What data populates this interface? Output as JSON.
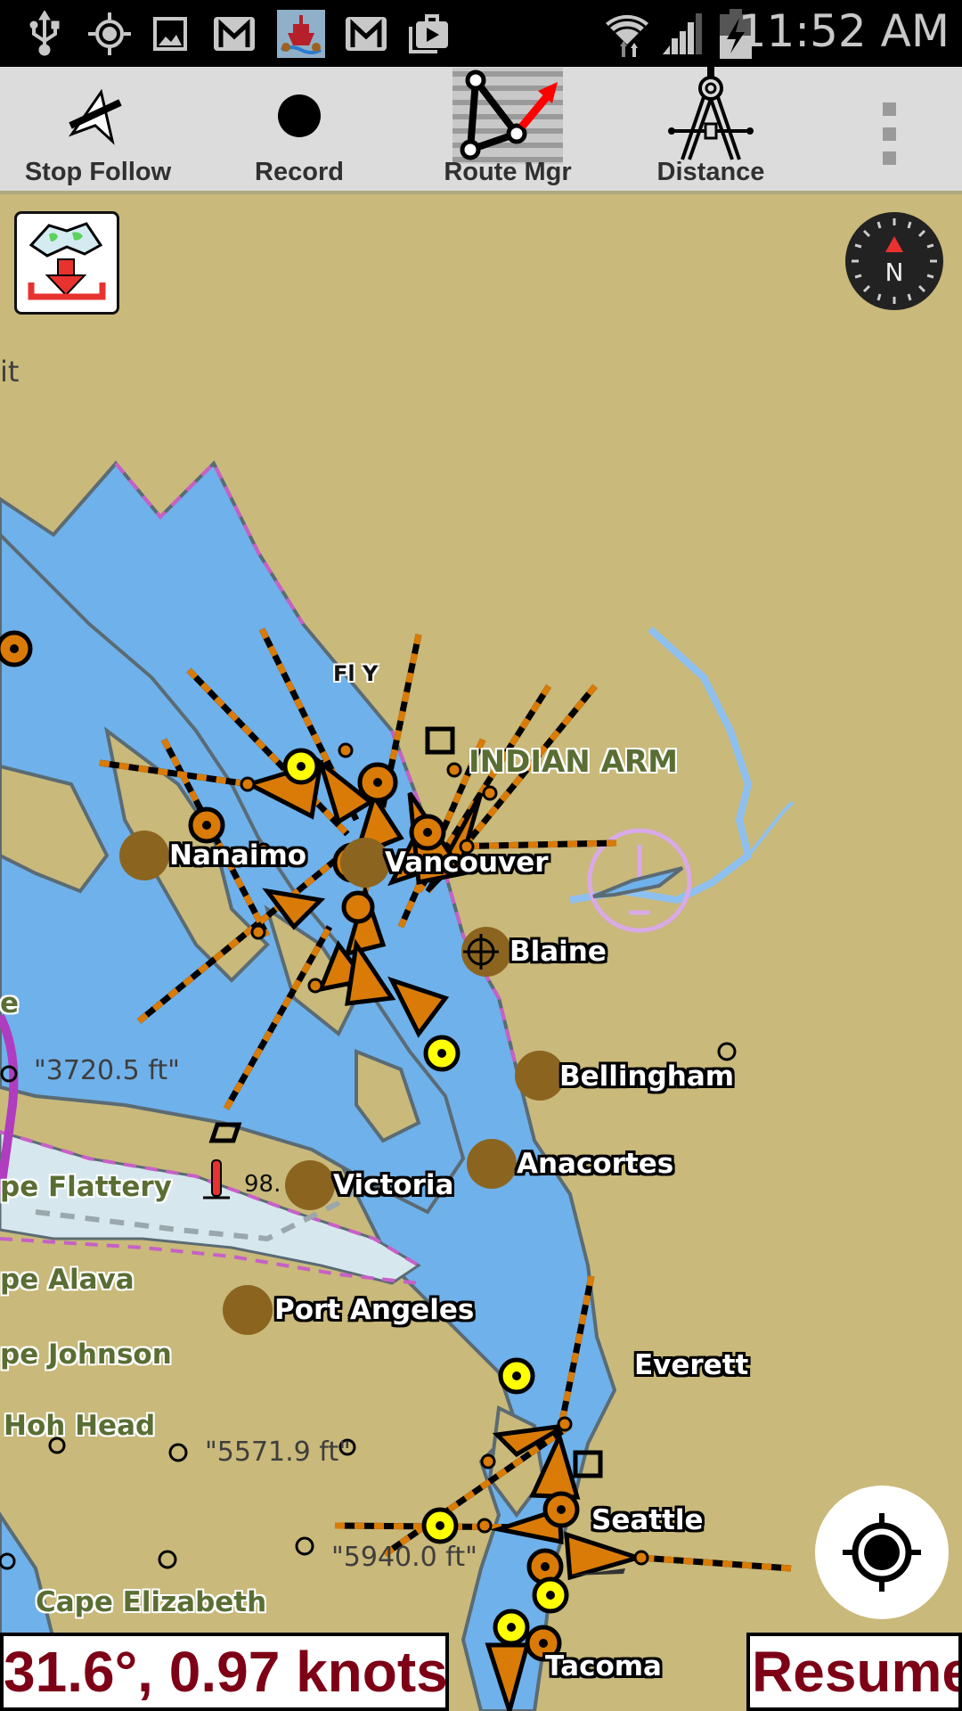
{
  "status_bar": {
    "time": "11:52 AM",
    "left_icons": [
      "usb-icon",
      "gps-icon",
      "gallery-icon",
      "gmail-icon",
      "app-boat-icon",
      "gmail-icon",
      "play-store-icon"
    ],
    "right_icons": [
      "wifi-icon",
      "signal-icon",
      "battery-charging-icon"
    ]
  },
  "action_bar": {
    "actions": [
      {
        "label": "Stop Follow",
        "icon": "stop-follow-icon"
      },
      {
        "label": "Record",
        "icon": "record-icon"
      },
      {
        "label": "Route Mgr",
        "icon": "route-manager-icon"
      },
      {
        "label": "Distance",
        "icon": "compass-divider-icon"
      }
    ],
    "overflow_icon": "more-vert-icon"
  },
  "map": {
    "colors": {
      "land": "#c9b97a",
      "water": "#6fb1ea",
      "shallow": "#d6e8ee",
      "route_orange": "#d97b06",
      "waypoint_yellow": "#ffff00",
      "city_dot": "#8b6520",
      "label_green": "#5a6e34",
      "accent_red": "#7d0016"
    },
    "cities": [
      {
        "name": "Nanaimo"
      },
      {
        "name": "Vancouver"
      },
      {
        "name": "Blaine"
      },
      {
        "name": "Bellingham"
      },
      {
        "name": "Anacortes"
      },
      {
        "name": "Victoria"
      },
      {
        "name": "Port Angeles"
      },
      {
        "name": "Everett"
      },
      {
        "name": "Seattle"
      },
      {
        "name": "Tacoma"
      }
    ],
    "landmarks": [
      {
        "name": "INDIAN ARM"
      },
      {
        "name": "pe Flattery"
      },
      {
        "name": "pe Alava"
      },
      {
        "name": "pe Johnson"
      },
      {
        "name": "Hoh Head"
      },
      {
        "name": "Cape Elizabeth"
      },
      {
        "name": "it"
      },
      {
        "name": "e"
      }
    ],
    "depths": [
      {
        "text": "\"3720.5 ft\""
      },
      {
        "text": "\"5571.9 ft\""
      },
      {
        "text": "\"5940.0 ft\""
      },
      {
        "text": "98."
      }
    ],
    "light_label": "Fl Y"
  },
  "overlay": {
    "download_maps_icon": "download-map-icon",
    "compass_label": "N",
    "locate_icon": "my-location-icon"
  },
  "bottom": {
    "heading_speed": "31.6°, 0.97 knots",
    "resume_label": "Resume"
  }
}
